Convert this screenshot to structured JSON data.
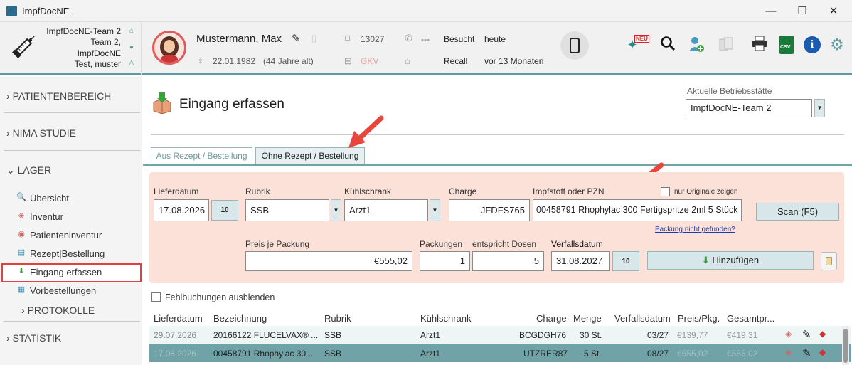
{
  "window": {
    "title": "ImpfDocNE",
    "minimize": "—",
    "maximize": "☐",
    "close": "✕"
  },
  "header": {
    "team_lines": [
      "ImpfDocNE-Team 2",
      "Team 2,",
      "ImpfDocNE",
      "Test, muster"
    ],
    "patient_name": "Mustermann, Max",
    "birthdate": "22.01.1982",
    "age": "(44 Jahre alt)",
    "tag_number": "13027",
    "phone": "---",
    "insurance": "GKV",
    "visited_label": "Besucht",
    "visited_value": "heute",
    "recall_label": "Recall",
    "recall_value": "vor 13 Monaten",
    "neu_badge": "NEU",
    "csv_label": "CSV"
  },
  "sidebar": {
    "sections": [
      "PATIENTENBEREICH",
      "NIMA STUDIE",
      "LAGER",
      "STATISTIK"
    ],
    "lager_items": [
      "Übersicht",
      "Inventur",
      "Patienteninventur",
      "Rezept|Bestellung",
      "Eingang erfassen",
      "Vorbestellungen"
    ],
    "protokolle": "PROTOKOLLE"
  },
  "page": {
    "title": "Eingang erfassen",
    "betriebsstaette_label": "Aktuelle Betriebsstätte",
    "betriebsstaette_value": "ImpfDocNE-Team 2",
    "tabs": [
      "Aus Rezept / Bestellung",
      "Ohne Rezept / Bestellung"
    ]
  },
  "form": {
    "lieferdatum_label": "Lieferdatum",
    "lieferdatum": "17.08.2026",
    "rubrik_label": "Rubrik",
    "rubrik": "SSB",
    "kuehlschrank_label": "Kühlschrank",
    "kuehlschrank": "Arzt1",
    "charge_label": "Charge",
    "charge": "JFDFS765",
    "impfstoff_label": "Impfstoff oder PZN",
    "impfstoff": "00458791 Rhophylac 300 Fertigspritze 2ml 5 Stück",
    "originale_label": "nur Originale zeigen",
    "scan_button": "Scan (F5)",
    "not_found_link": "Packung nicht gefunden?",
    "preis_label": "Preis je Packung",
    "preis": "€555,02",
    "packungen_label": "Packungen",
    "packungen": "1",
    "dosen_label": "entspricht Dosen",
    "dosen": "5",
    "verfall_label": "Verfallsdatum",
    "verfall": "31.08.2027",
    "add_button": "Hinzufügen",
    "cal_icon_text": "10",
    "fehl_label": "Fehlbuchungen ausblenden"
  },
  "table": {
    "columns": [
      "Lieferdatum",
      "Bezeichnung",
      "Rubrik",
      "Kühlschrank",
      "Charge",
      "Menge",
      "Verfallsdatum",
      "Preis/Pkg.",
      "Gesamtpr..."
    ],
    "rows": [
      [
        "29.07.2026",
        "20166122 FLUCELVAX® ...",
        "SSB",
        "Arzt1",
        "BCGDGH76",
        "30 St.",
        "03/27",
        "€139,77",
        "€419,31"
      ],
      [
        "17.08.2026",
        "00458791 Rhophylac 30...",
        "SSB",
        "Arzt1",
        "UTZRER87",
        "5 St.",
        "08/27",
        "€555,02",
        "€555,02"
      ]
    ]
  },
  "colors": {
    "accent": "#5a9aa0",
    "form_bg": "#fbe1d8",
    "selected_row": "#6fa3a7",
    "highlight": "#e04040"
  }
}
